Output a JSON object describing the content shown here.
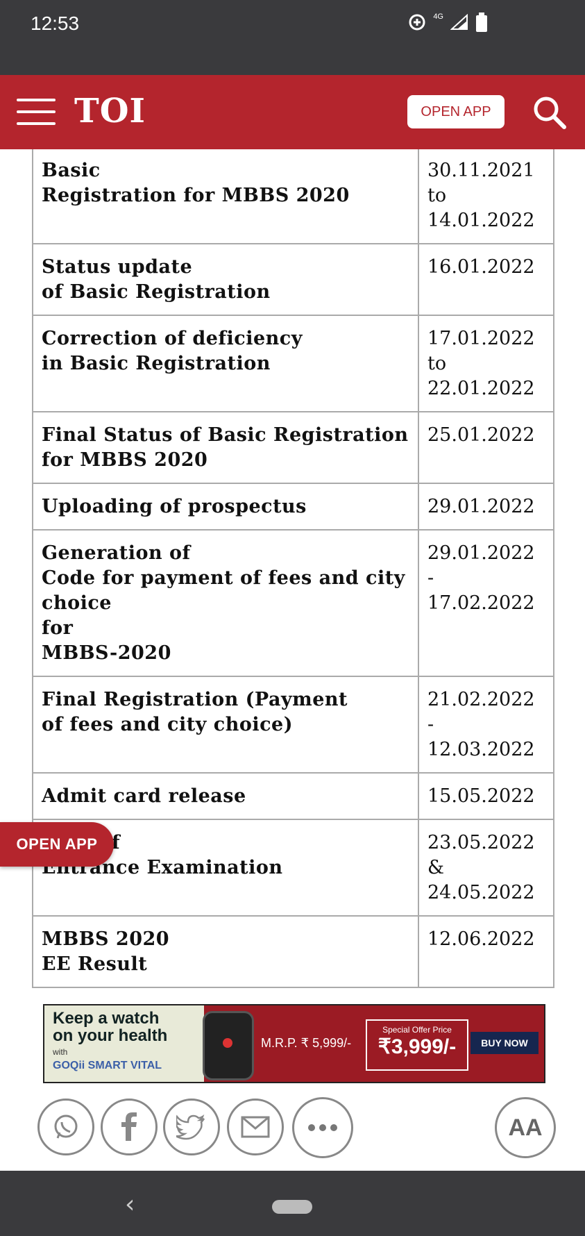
{
  "status_bar": {
    "time": "12:53",
    "network": "4G"
  },
  "header": {
    "logo": "TOI",
    "open_app_label": "OPEN APP"
  },
  "schedule": [
    {
      "event": "Basic\nRegistration for MBBS 2020",
      "date": "30.11.2021\nto\n14.01.2022"
    },
    {
      "event": "Status update\nof Basic Registration",
      "date": "16.01.2022"
    },
    {
      "event": "Correction of deficiency\nin Basic Registration",
      "date": "17.01.2022\nto\n22.01.2022"
    },
    {
      "event": "Final Status of Basic Registration\nfor MBBS 2020",
      "date": "25.01.2022"
    },
    {
      "event": "Uploading of prospectus",
      "date": "29.01.2022"
    },
    {
      "event": "Generation of\nCode for payment of fees and city\nchoice\nfor\nMBBS-2020",
      "date": "29.01.2022\n-\n17.02.2022"
    },
    {
      "event": "Final Registration (Payment\nof fees and city choice)",
      "date": "21.02.2022\n-\n12.03.2022"
    },
    {
      "event": "Admit card release",
      "date": "15.05.2022"
    },
    {
      "event": "Date of\nEntrance Examination",
      "date": "23.05.2022\n&\n24.05.2022"
    },
    {
      "event": "MBBS 2020\nEE Result",
      "date": "12.06.2022"
    }
  ],
  "floating": {
    "open_app_label": "OPEN APP"
  },
  "ad": {
    "headline": "Keep a watch\non your health",
    "with": "with",
    "brand": "GOQii SMART VITAL",
    "mrp": "M.R.P. ₹ 5,999/-",
    "offer_label": "Special Offer Price",
    "offer_price": "₹3,999/-",
    "cta": "BUY NOW"
  },
  "share_icons": [
    "whatsapp-icon",
    "facebook-icon",
    "twitter-icon",
    "mail-icon",
    "more-icon",
    "font-size-icon"
  ],
  "font_size_label": "AA",
  "colors": {
    "brand_red": "#b4252d",
    "system_bar": "#3a3a3d"
  }
}
